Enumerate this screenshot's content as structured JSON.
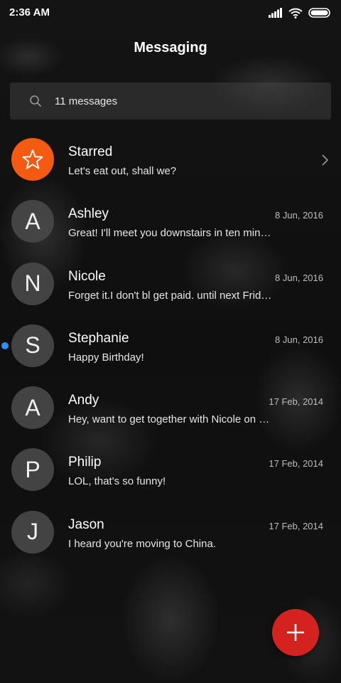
{
  "status_bar": {
    "time": "2:36 AM",
    "icons": [
      "signal-icon",
      "wifi-icon",
      "battery-icon"
    ]
  },
  "header": {
    "title": "Messaging"
  },
  "search": {
    "text": "11 messages",
    "icon": "search-icon"
  },
  "conversations": [
    {
      "avatar": "",
      "icon": "star-icon",
      "name": "Starred",
      "preview": "Let's eat out, shall we?",
      "date": "",
      "unread": false,
      "color": "#f45a10"
    },
    {
      "avatar": "A",
      "name": "Ashley",
      "preview": "Great! I'll meet you downstairs in ten min…",
      "date": "8 Jun, 2016",
      "unread": false
    },
    {
      "avatar": "N",
      "name": "Nicole",
      "preview": "Forget it.I don't bl get paid. until next Frid…",
      "date": "8 Jun, 2016",
      "unread": false
    },
    {
      "avatar": "S",
      "name": "Stephanie",
      "preview": "Happy Birthday!",
      "date": "8 Jun, 2016",
      "unread": true
    },
    {
      "avatar": "A",
      "name": "Andy",
      "preview": "Hey, want to get together with Nicole on …",
      "date": "17 Feb, 2014",
      "unread": false
    },
    {
      "avatar": "P",
      "name": "Philip",
      "preview": "LOL, that's so funny!",
      "date": "17 Feb, 2014",
      "unread": false
    },
    {
      "avatar": "J",
      "name": "Jason",
      "preview": "I heard you're moving to China.",
      "date": "17 Feb, 2014",
      "unread": false
    }
  ],
  "fab": {
    "icon": "plus-icon",
    "color": "#d4231f"
  },
  "colors": {
    "unread_dot": "#2f8df5",
    "starred_avatar": "#f45a10"
  }
}
